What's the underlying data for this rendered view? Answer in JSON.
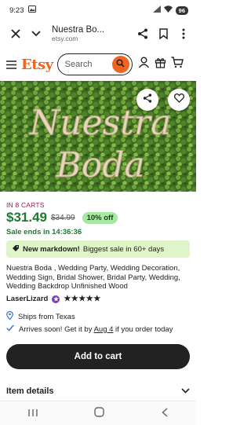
{
  "status_bar": {
    "time": "9:23",
    "battery": "96"
  },
  "browser": {
    "title": "Nuestra Bo...",
    "url": "etsy.com"
  },
  "header": {
    "logo": "Etsy",
    "search_placeholder": "Search"
  },
  "hero": {
    "sign_line1": "Nuestra",
    "sign_line2": "Boda"
  },
  "product": {
    "carts": "IN 8 CARTS",
    "price": "$31.49",
    "original_price": "$34.99",
    "discount": "10% off",
    "sale_ends": "Sale ends in 14:36:36",
    "markdown_bold": "New markdown!",
    "markdown_rest": "Biggest sale in 60+ days",
    "description": "Nuestra Boda , Wedding Party, Wedding Decoration, Wedding Sign, Bridal Shower, Bridal Party, Wedding, Wedding Backdrop Unfinished Wood",
    "seller": "LaserLizard",
    "stars": "★★★★★",
    "rating": 5,
    "ships_from": "Ships from Texas",
    "arrives_pre": "Arrives soon! Get it by ",
    "arrives_date": "Aug 4",
    "arrives_post": " if you order today",
    "add_to_cart": "Add to cart",
    "item_details": "Item details"
  },
  "colors": {
    "brand": "#F1641E",
    "price": "#1d7a2e",
    "carts": "#B3124B",
    "discount_bg": "#a7e8a2",
    "markdown_bg": "#dff5c8"
  },
  "icons": [
    "close-icon",
    "chevron-down-icon",
    "share-icon",
    "bookmark-icon",
    "more-vert-icon",
    "menu-icon",
    "search-icon",
    "account-icon",
    "gift-icon",
    "cart-icon",
    "heart-icon",
    "tag-icon",
    "star-seller-icon",
    "location-icon",
    "check-icon",
    "chevron-down-icon"
  ]
}
